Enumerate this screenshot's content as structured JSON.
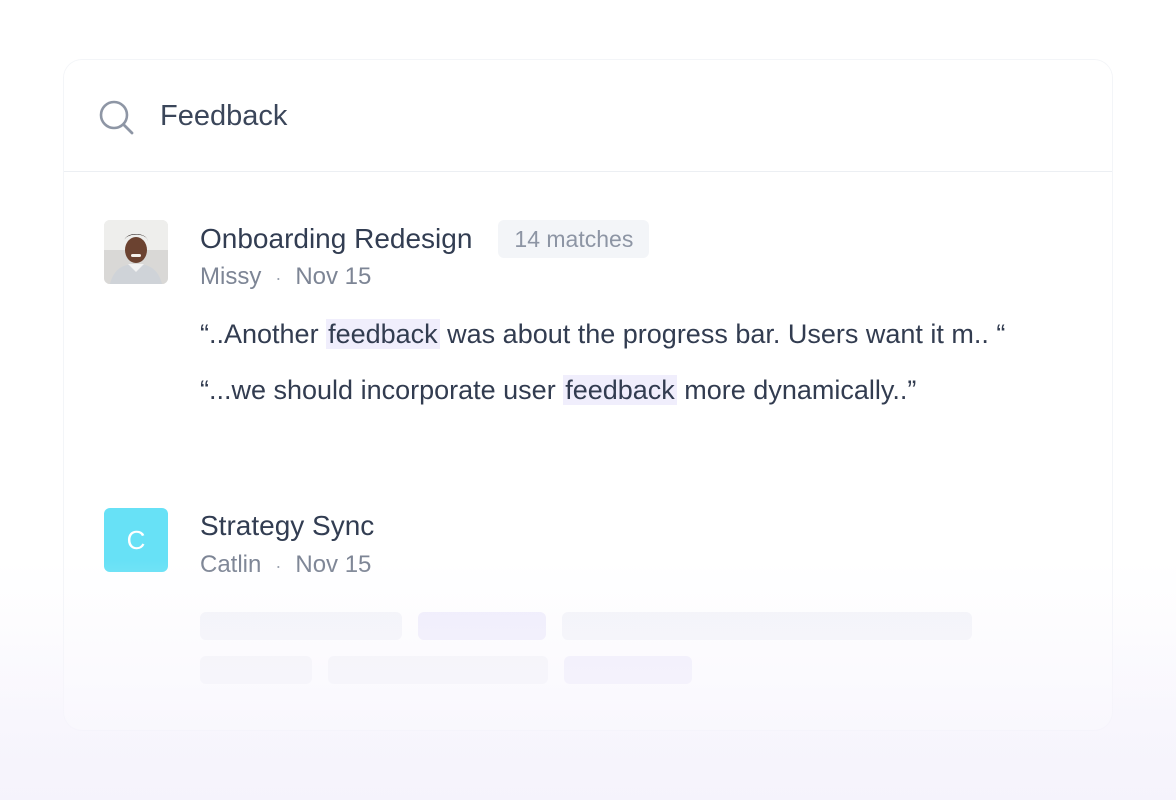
{
  "search": {
    "value": "Feedback",
    "icon": "search-icon"
  },
  "results": [
    {
      "title": "Onboarding Redesign",
      "matches": "14 matches",
      "author": "Missy",
      "separator": "·",
      "date": "Nov 15",
      "snippets": [
        {
          "before": "“..Another ",
          "highlight": "feedback",
          "after": " was about the progress bar. Users want it m.. “"
        },
        {
          "before": "“...we should incorporate user ",
          "highlight": "feedback",
          "after": " more dynamically..”"
        }
      ]
    },
    {
      "title": "Strategy Sync",
      "avatar_letter": "C",
      "author": "Catlin",
      "separator": "·",
      "date": "Nov 15"
    }
  ],
  "colors": {
    "accent_avatar": "#67e1f6",
    "highlight": "#f0eefc",
    "text_primary": "#323d52",
    "text_muted": "#7d8595"
  }
}
